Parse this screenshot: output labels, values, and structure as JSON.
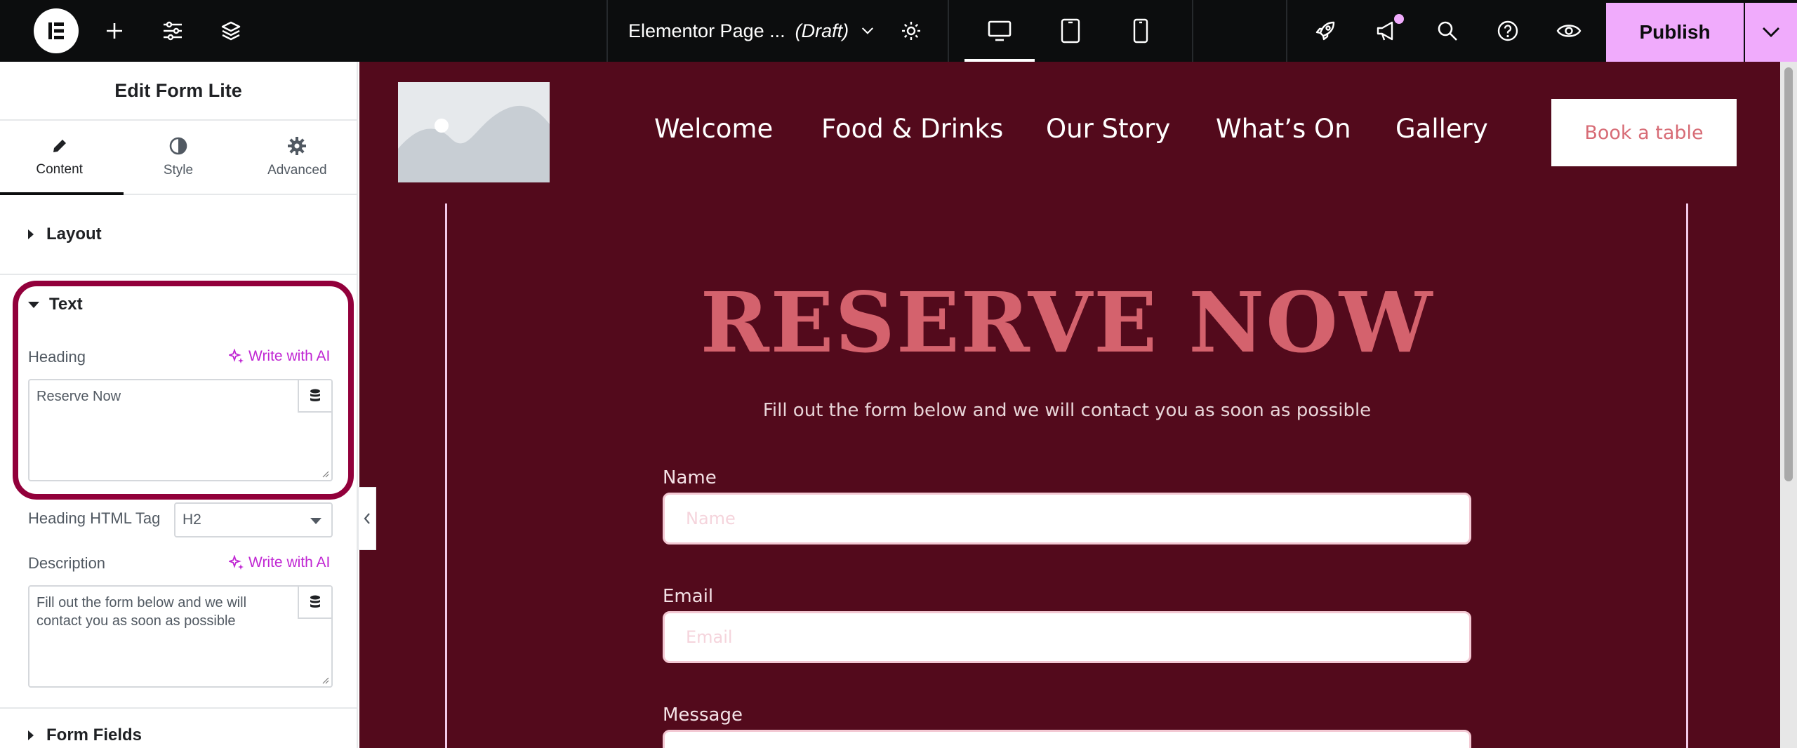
{
  "topbar": {
    "page_title": "Elementor Page ...",
    "page_status": "(Draft)",
    "publish_label": "Publish",
    "accent_color": "#f0abfc",
    "icons": [
      "elementor-logo-icon",
      "add-icon",
      "site-settings-icon",
      "structure-layers-icon",
      "chevron-down-icon",
      "gear-icon",
      "desktop-icon",
      "tablet-icon",
      "mobile-icon",
      "rocket-icon",
      "megaphone-icon",
      "search-icon",
      "help-icon",
      "preview-eye-icon",
      "chevron-down-icon"
    ]
  },
  "panel": {
    "title": "Edit Form Lite",
    "tabs": [
      {
        "label": "Content",
        "icon": "pencil-icon",
        "active": true
      },
      {
        "label": "Style",
        "icon": "half-circle-icon",
        "active": false
      },
      {
        "label": "Advanced",
        "icon": "gear-icon",
        "active": false
      }
    ],
    "sections": {
      "layout": "Layout",
      "text": "Text",
      "form_fields": "Form Fields"
    },
    "heading_label": "Heading",
    "write_ai": "Write with AI",
    "heading_value": "Reserve Now",
    "heading_tag_label": "Heading HTML Tag",
    "heading_tag_value": "H2",
    "description_label": "Description",
    "description_value": "Fill out the form below and we will contact you as soon as possible",
    "highlight_color": "#92003b"
  },
  "site": {
    "nav": [
      "Welcome",
      "Food & Drinks",
      "Our Story",
      "What’s On",
      "Gallery"
    ],
    "cta": "Book a table",
    "hero_title": "RESERVE NOW",
    "hero_subtitle": "Fill out the form below and we will contact you as soon as possible",
    "form": {
      "name_label": "Name",
      "name_placeholder": "Name",
      "email_label": "Email",
      "email_placeholder": "Email",
      "message_label": "Message"
    },
    "bg_color": "#530a1c",
    "title_color": "#d4626d"
  }
}
